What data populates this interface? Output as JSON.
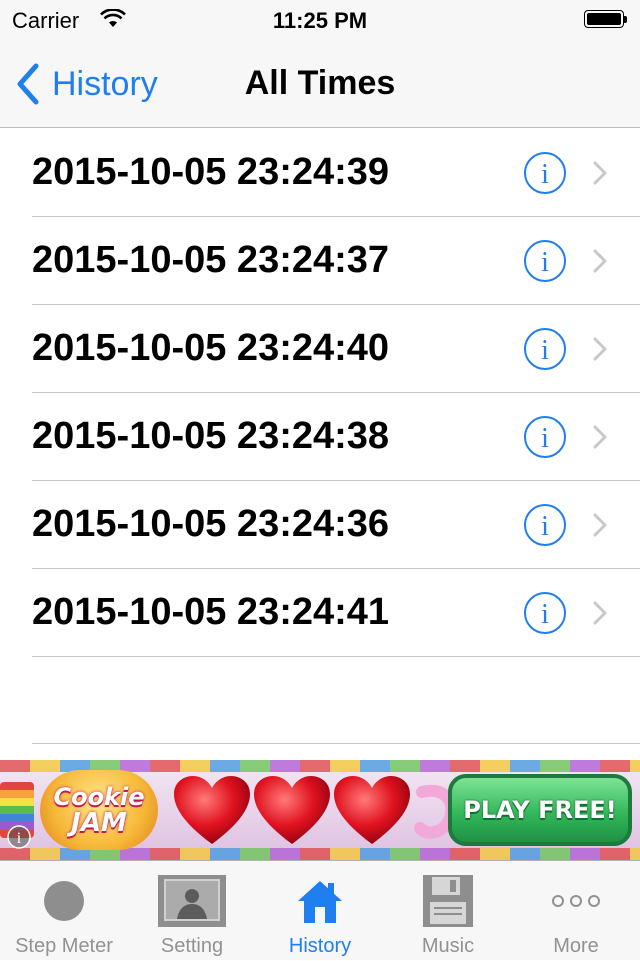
{
  "status_bar": {
    "carrier": "Carrier",
    "time": "11:25 PM"
  },
  "nav": {
    "back_label": "History",
    "title": "All Times"
  },
  "rows": [
    {
      "label": "2015-10-05 23:24:39"
    },
    {
      "label": "2015-10-05 23:24:37"
    },
    {
      "label": "2015-10-05 23:24:40"
    },
    {
      "label": "2015-10-05 23:24:38"
    },
    {
      "label": "2015-10-05 23:24:36"
    },
    {
      "label": "2015-10-05 23:24:41"
    }
  ],
  "row_icons": {
    "info": "info-circle-icon",
    "disclosure": "chevron-right-icon"
  },
  "ad": {
    "logo_line1": "Cookie",
    "logo_line2": "JAM",
    "cta": "PLAY FREE!"
  },
  "tabs": [
    {
      "label": "Step Meter",
      "icon": "circle-icon",
      "active": false
    },
    {
      "label": "Setting",
      "icon": "photo-frame-icon",
      "active": false
    },
    {
      "label": "History",
      "icon": "house-icon",
      "active": true
    },
    {
      "label": "Music",
      "icon": "floppy-disk-icon",
      "active": false
    },
    {
      "label": "More",
      "icon": "ellipsis-icon",
      "active": false
    }
  ],
  "colors": {
    "accent": "#1f7ef0",
    "tab_inactive": "#929292",
    "separator": "#c8c7cc",
    "bar_background": "#f7f7f7"
  }
}
